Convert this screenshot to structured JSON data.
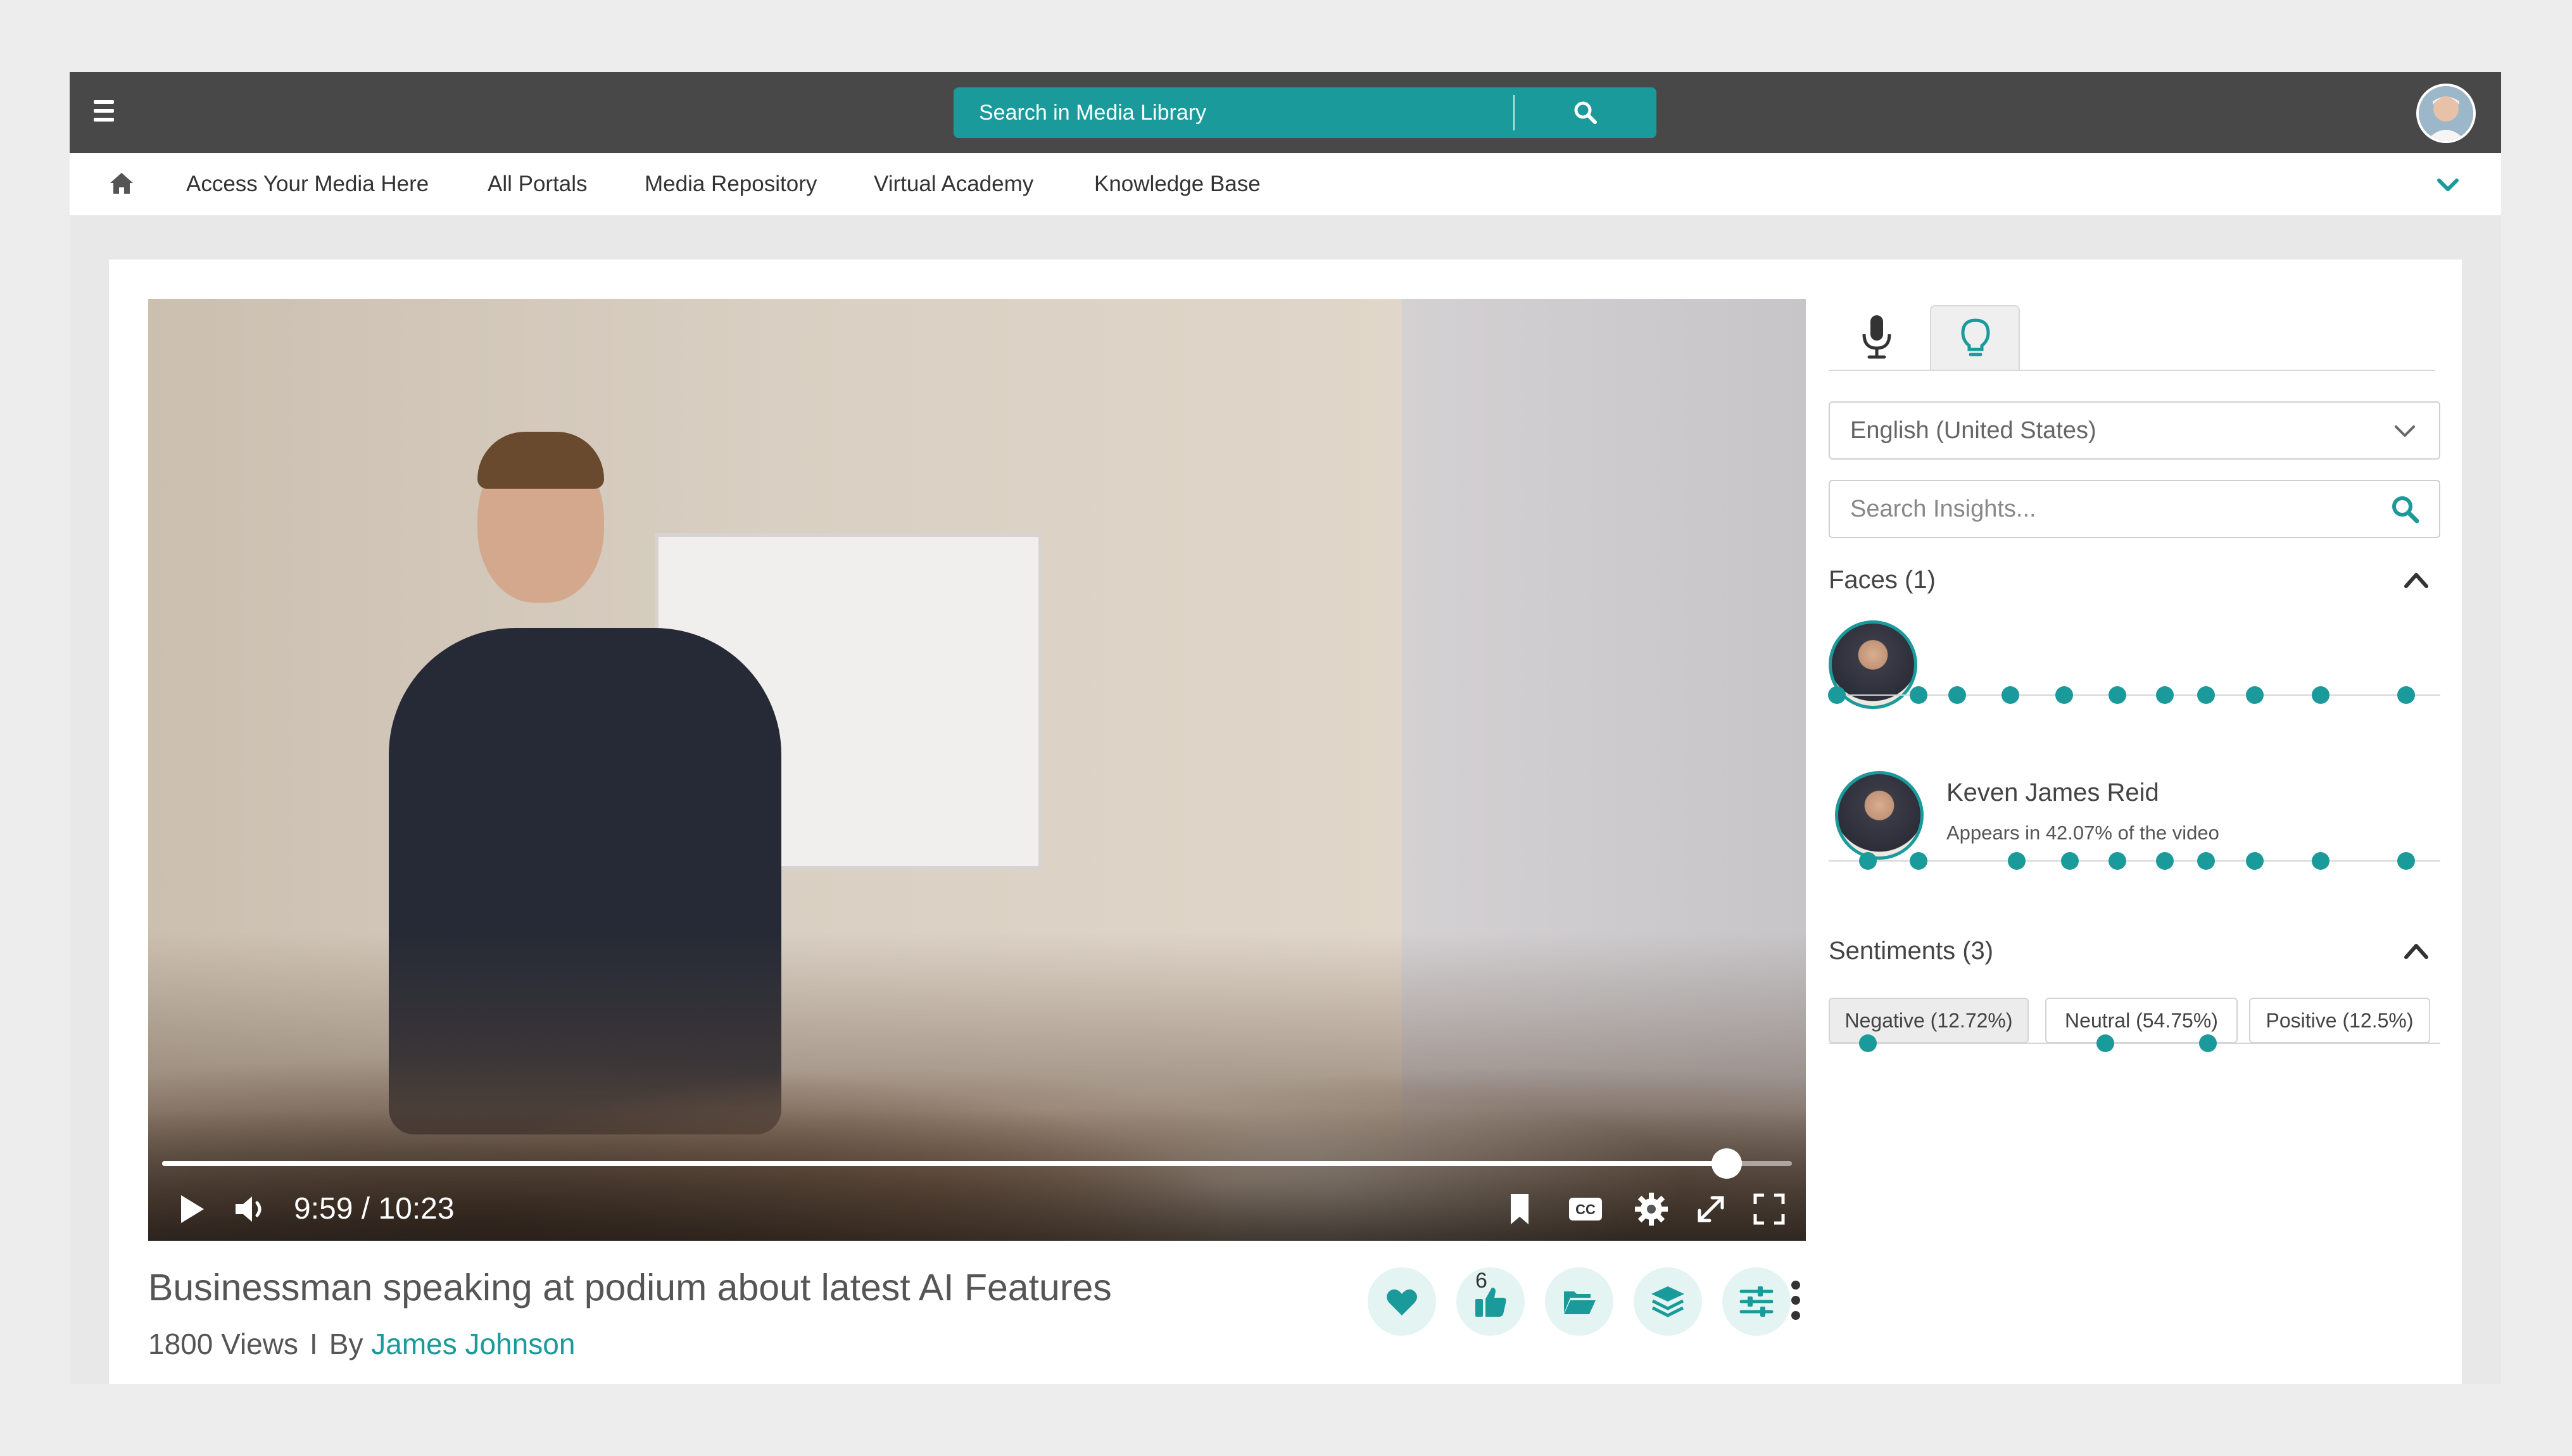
{
  "topbar": {
    "search_placeholder": "Search in Media Library",
    "brand_color": "#1a9a9a"
  },
  "nav": {
    "items": [
      "Access Your Media Here",
      "All Portals",
      "Media Repository",
      "Virtual Academy",
      "Knowledge Base"
    ]
  },
  "player": {
    "time": "9:59 / 10:23",
    "progress": 0.96
  },
  "video_info": {
    "title": "Businessman speaking at podium about latest AI Features",
    "views": "1800 Views",
    "separator": "I",
    "by_label": "By",
    "author": "James Johnson",
    "like_count": "6"
  },
  "panel": {
    "language": "English (United States)",
    "search_placeholder": "Search Insights...",
    "faces": {
      "title": "Faces (1)",
      "timeline_dots": [
        0.013,
        0.147,
        0.21,
        0.297,
        0.385,
        0.472,
        0.55,
        0.617,
        0.697,
        0.804,
        0.944
      ],
      "person": {
        "name": "Keven James Reid",
        "appearance": "Appears in 42.07% of the video",
        "timeline_dots": [
          0.064,
          0.147,
          0.307,
          0.394,
          0.472,
          0.55,
          0.617,
          0.697,
          0.804,
          0.944
        ]
      }
    },
    "sentiments": {
      "title": "Sentiments (3)",
      "chips": [
        "Negative (12.72%)",
        "Neutral (54.75%)",
        "Positive (12.5%)"
      ],
      "timeline_dots": [
        0.064,
        0.452,
        0.62
      ]
    }
  },
  "icons": [
    "menu-icon",
    "search-icon",
    "home-icon",
    "chevron-down-icon",
    "play-icon",
    "volume-icon",
    "bookmark-icon",
    "cc-icon",
    "gear-icon",
    "pip-icon",
    "fullscreen-icon",
    "heart-icon",
    "thumbs-up-icon",
    "folder-icon",
    "layers-icon",
    "sliders-icon",
    "more-vertical-icon",
    "microphone-icon",
    "lightbulb-icon",
    "chevron-up-icon"
  ]
}
